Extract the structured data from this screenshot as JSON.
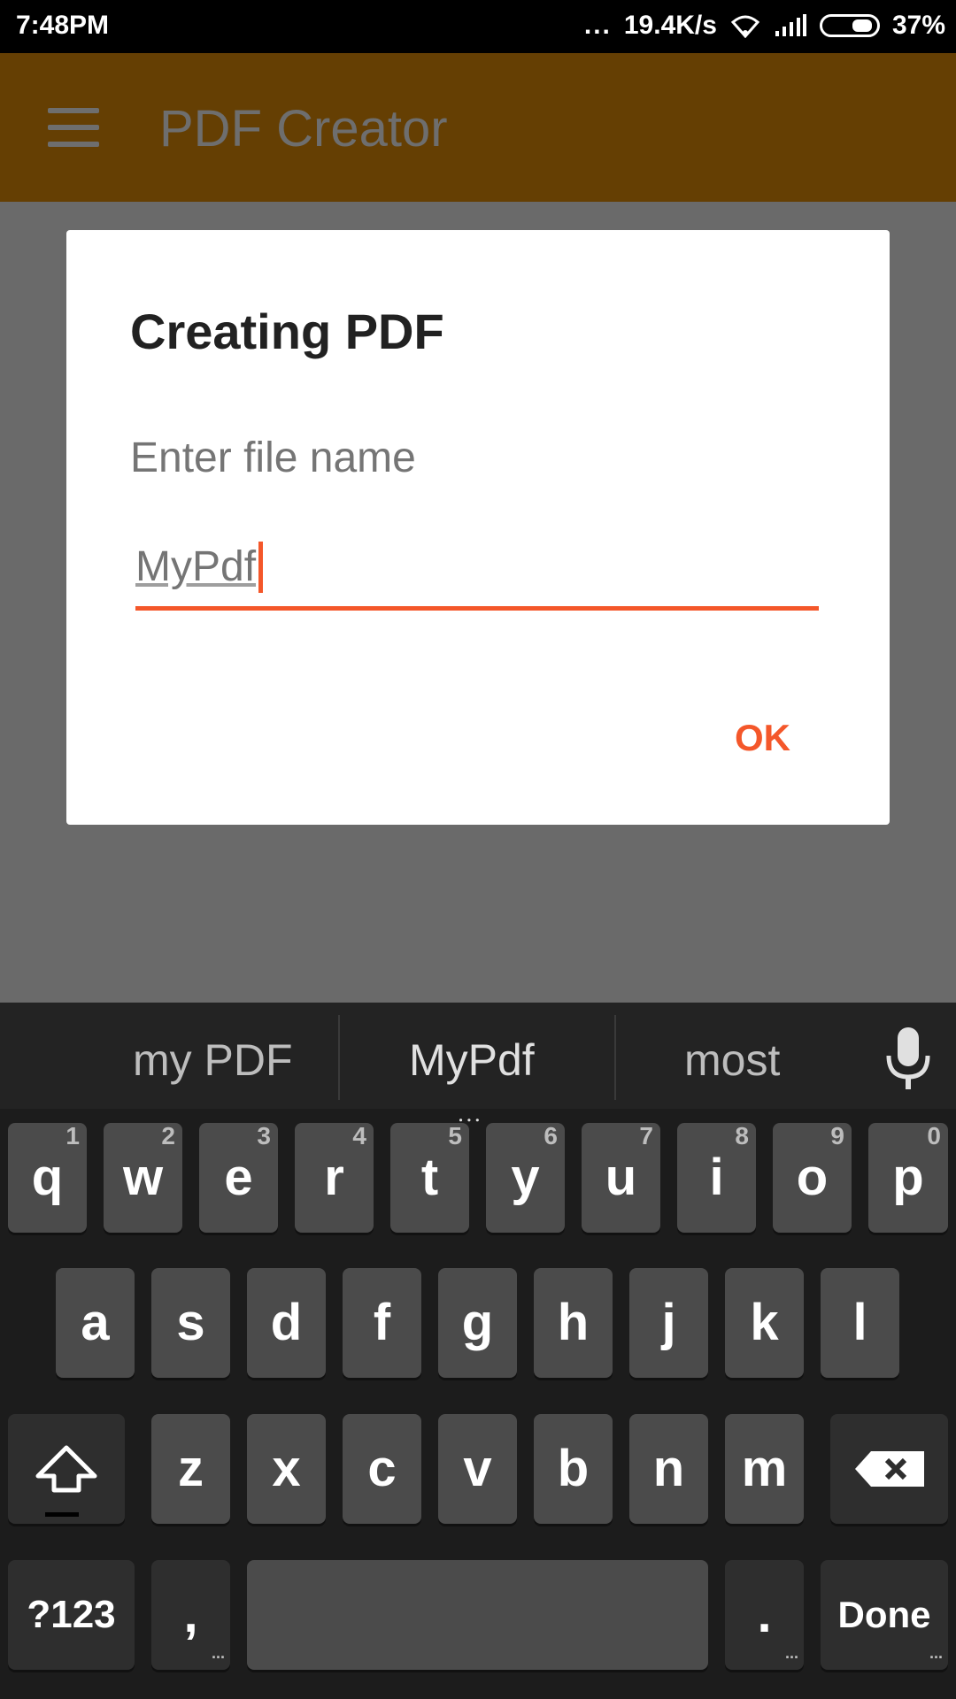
{
  "status_bar": {
    "time": "7:48PM",
    "dots": "...",
    "speed": "19.4K/s",
    "battery": "37%"
  },
  "app_bar": {
    "title": "PDF Creator"
  },
  "dialog": {
    "title": "Creating PDF",
    "message": "Enter file name",
    "input_value": "MyPdf",
    "ok_label": "OK"
  },
  "keyboard": {
    "suggestions": [
      "my PDF",
      "MyPdf",
      "most"
    ],
    "suggestion_dots": "...",
    "row1": [
      {
        "key": "q",
        "sub": "1"
      },
      {
        "key": "w",
        "sub": "2"
      },
      {
        "key": "e",
        "sub": "3"
      },
      {
        "key": "r",
        "sub": "4"
      },
      {
        "key": "t",
        "sub": "5"
      },
      {
        "key": "y",
        "sub": "6"
      },
      {
        "key": "u",
        "sub": "7"
      },
      {
        "key": "i",
        "sub": "8"
      },
      {
        "key": "o",
        "sub": "9"
      },
      {
        "key": "p",
        "sub": "0"
      }
    ],
    "row2": [
      "a",
      "s",
      "d",
      "f",
      "g",
      "h",
      "j",
      "k",
      "l"
    ],
    "row3": [
      "z",
      "x",
      "c",
      "v",
      "b",
      "n",
      "m"
    ],
    "symbols_label": "?123",
    "comma_label": ",",
    "period_label": ".",
    "done_label": "Done",
    "more_dots": "..."
  },
  "colors": {
    "accent": "#f4572a",
    "app_bar": "#653f03",
    "scrim": "#6a6a6a"
  }
}
